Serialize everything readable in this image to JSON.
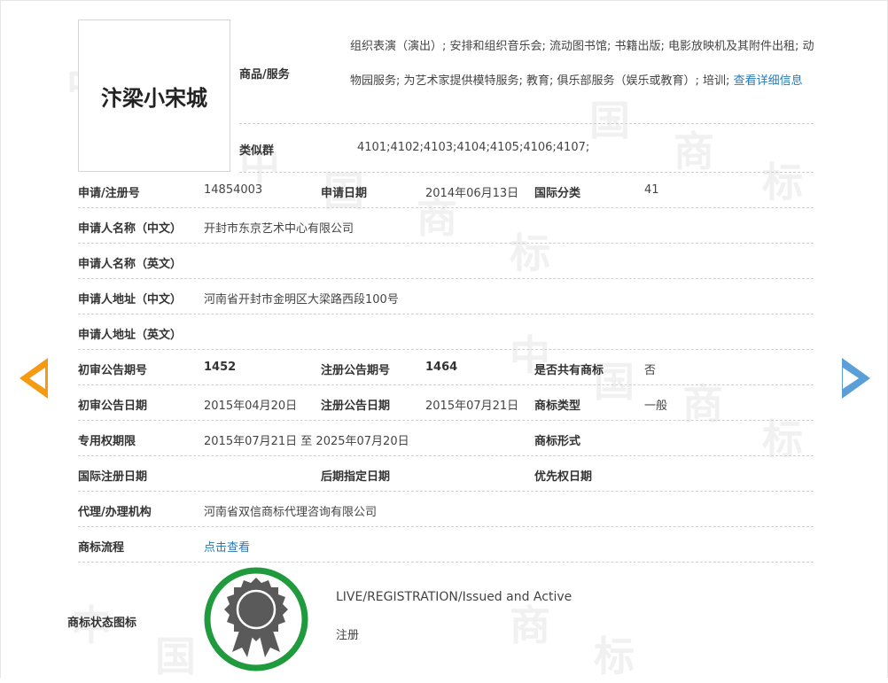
{
  "watermark": {
    "chars": [
      "中",
      "国",
      "商",
      "标",
      "中",
      "国",
      "商",
      "标",
      "中",
      "国",
      "商",
      "标",
      "中",
      "国",
      "商",
      "标"
    ]
  },
  "logo": {
    "text": "汴梁小宋城"
  },
  "goods": {
    "label": "商品/服务",
    "text": "组织表演（演出）; 安排和组织音乐会; 流动图书馆; 书籍出版; 电影放映机及其附件出租; 动物园服务; 为艺术家提供模特服务; 教育; 俱乐部服务（娱乐或教育）; 培训; ",
    "more_link": "查看详细信息"
  },
  "similar_group": {
    "label": "类似群",
    "value": "4101;4102;4103;4104;4105;4106;4107;"
  },
  "rows": {
    "reg_no_label": "申请/注册号",
    "reg_no": "14854003",
    "apply_date_label": "申请日期",
    "apply_date": "2014年06月13日",
    "intl_class_label": "国际分类",
    "intl_class": "41",
    "applicant_cn_label": "申请人名称（中文）",
    "applicant_cn": "开封市东京艺术中心有限公司",
    "applicant_en_label": "申请人名称（英文）",
    "applicant_en": "",
    "address_cn_label": "申请人地址（中文）",
    "address_cn": "河南省开封市金明区大梁路西段100号",
    "address_en_label": "申请人地址（英文）",
    "address_en": "",
    "prelim_no_label": "初审公告期号",
    "prelim_no": "1452",
    "reg_pub_no_label": "注册公告期号",
    "reg_pub_no": "1464",
    "shared_label": "是否共有商标",
    "shared": "否",
    "prelim_date_label": "初审公告日期",
    "prelim_date": "2015年04月20日",
    "reg_pub_date_label": "注册公告日期",
    "reg_pub_date": "2015年07月21日",
    "tm_type_label": "商标类型",
    "tm_type": "一般",
    "exclusive_label": "专用权期限",
    "exclusive": "2015年07月21日 至 2025年07月20日",
    "tm_form_label": "商标形式",
    "tm_form": "",
    "intl_reg_label": "国际注册日期",
    "intl_reg": "",
    "later_label": "后期指定日期",
    "later": "",
    "priority_label": "优先权日期",
    "priority": "",
    "agent_label": "代理/办理机构",
    "agent": "河南省双信商标代理咨询有限公司",
    "flow_label": "商标流程",
    "flow_link": "点击查看",
    "status_label": "商标状态图标",
    "status_en": "LIVE/REGISTRATION/Issued and Active",
    "status_cn": "注册"
  },
  "colors": {
    "accent_link": "#2a7ab8",
    "status_ring": "#1f9a3c",
    "prev_arrow": "#f59a11",
    "next_arrow": "#5a9fd8"
  }
}
